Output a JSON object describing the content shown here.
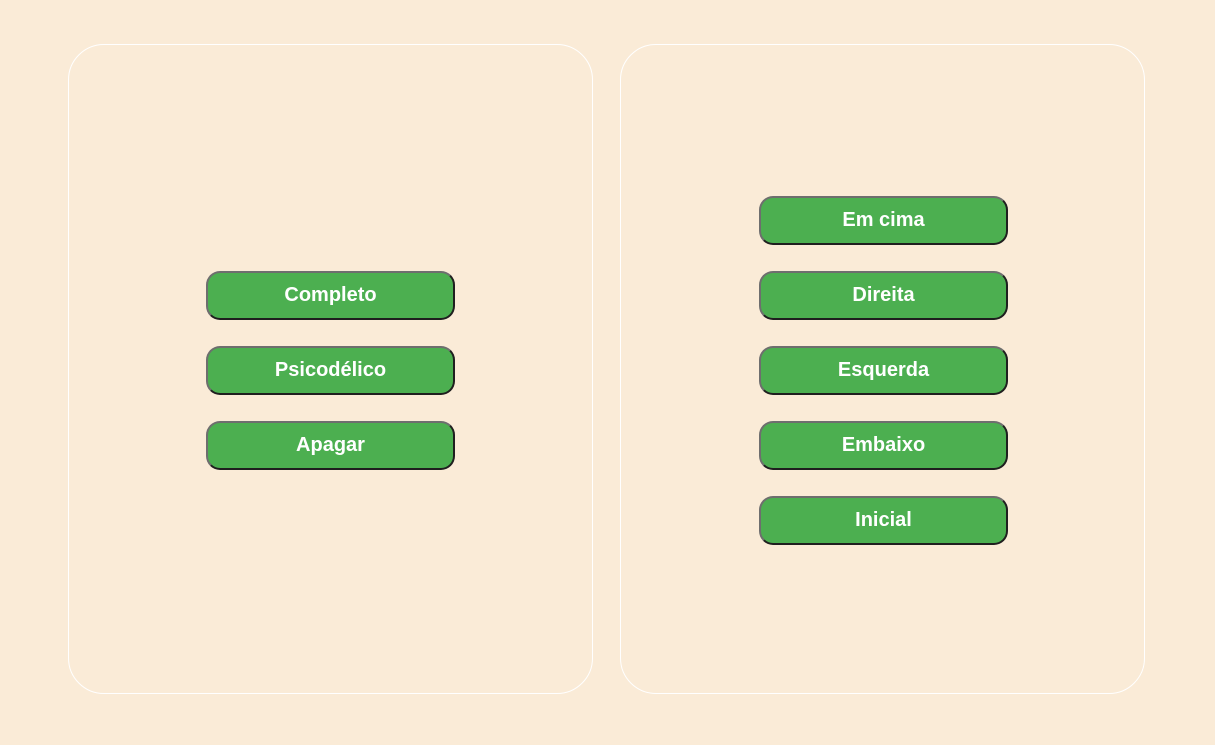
{
  "colors": {
    "background": "#FAEBD7",
    "button": "#4CAF50",
    "button_text": "#FFFFFF",
    "panel_border": "#FFFFFF"
  },
  "left_panel": {
    "buttons": [
      {
        "label": "Completo"
      },
      {
        "label": "Psicodélico"
      },
      {
        "label": "Apagar"
      }
    ]
  },
  "right_panel": {
    "buttons": [
      {
        "label": "Em cima"
      },
      {
        "label": "Direita"
      },
      {
        "label": "Esquerda"
      },
      {
        "label": "Embaixo"
      },
      {
        "label": "Inicial"
      }
    ]
  }
}
